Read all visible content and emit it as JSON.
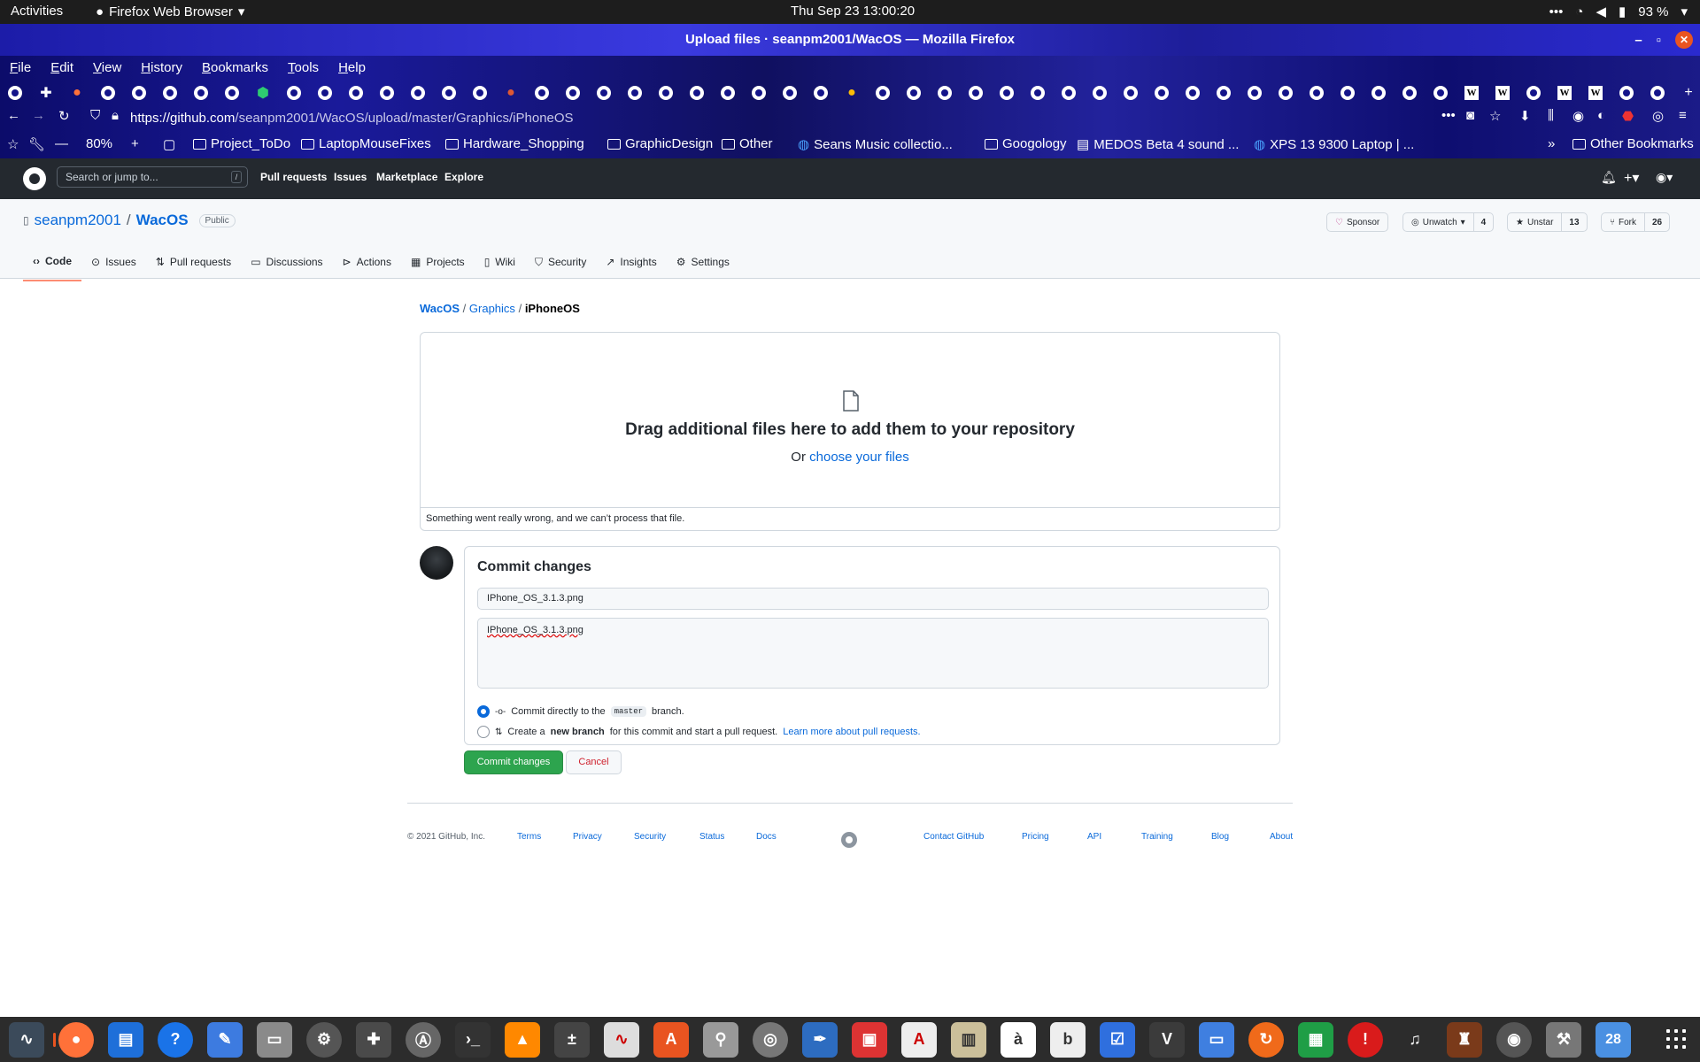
{
  "system_bar": {
    "activities": "Activities",
    "app_name": "Firefox Web Browser",
    "clock": "Thu Sep 23  13:00:20",
    "battery": "93 %"
  },
  "window": {
    "title": "Upload files · seanpm2001/WacOS — Mozilla Firefox"
  },
  "menubar": [
    "File",
    "Edit",
    "View",
    "History",
    "Bookmarks",
    "Tools",
    "Help"
  ],
  "navbar": {
    "url_host": "https://github.com",
    "url_path": "/seanpm2001/WacOS/upload/master/Graphics/iPhoneOS",
    "zoom": "80%"
  },
  "bookmarks": [
    "Project_ToDo",
    "LaptopMouseFixes",
    "Hardware_Shopping",
    "GraphicDesign",
    "Other",
    "Seans Music collectio...",
    "Googology",
    "MEDOS Beta 4 sound ...",
    "XPS 13 9300 Laptop | ...",
    "Other Bookmarks"
  ],
  "gh_header": {
    "search_placeholder": "Search or jump to...",
    "search_key": "/",
    "nav": [
      "Pull requests",
      "Issues",
      "Marketplace",
      "Explore"
    ]
  },
  "repo": {
    "owner": "seanpm2001",
    "separator": "/",
    "name": "WacOS",
    "visibility": "Public",
    "sponsor": "Sponsor",
    "watch": "Unwatch",
    "watch_count": "4",
    "star": "Unstar",
    "star_count": "13",
    "fork": "Fork",
    "fork_count": "26",
    "tabs": [
      "Code",
      "Issues",
      "Pull requests",
      "Discussions",
      "Actions",
      "Projects",
      "Wiki",
      "Security",
      "Insights",
      "Settings"
    ]
  },
  "breadcrumb": {
    "root": "WacOS",
    "folder": "Graphics",
    "current": "iPhoneOS",
    "sep": "/"
  },
  "dropzone": {
    "headline": "Drag additional files here to add them to your repository",
    "or": "Or ",
    "choose": "choose your files",
    "error": "Something went really wrong, and we can’t process that file."
  },
  "commit": {
    "title": "Commit changes",
    "summary_value": "IPhone_OS_3.1.3.png",
    "description_value": "IPhone_OS_3.1.3.png",
    "option1_pre": "Commit directly to the",
    "option1_branch": "master",
    "option1_post": "branch.",
    "option2_pre": "Create a",
    "option2_bold": "new branch",
    "option2_post": "for this commit and start a pull request.",
    "option2_link": "Learn more about pull requests.",
    "submit": "Commit changes",
    "cancel": "Cancel"
  },
  "footer": {
    "copyright": "© 2021 GitHub, Inc.",
    "left_links": [
      "Terms",
      "Privacy",
      "Security",
      "Status",
      "Docs"
    ],
    "right_links": [
      "Contact GitHub",
      "Pricing",
      "API",
      "Training",
      "Blog",
      "About"
    ]
  },
  "dock": {
    "calendar_day": "28"
  },
  "colors": {
    "accent_link": "#0969da",
    "commit_green": "#2da44e",
    "cancel_red": "#cf222e",
    "gh_header_bg": "#24292f"
  }
}
